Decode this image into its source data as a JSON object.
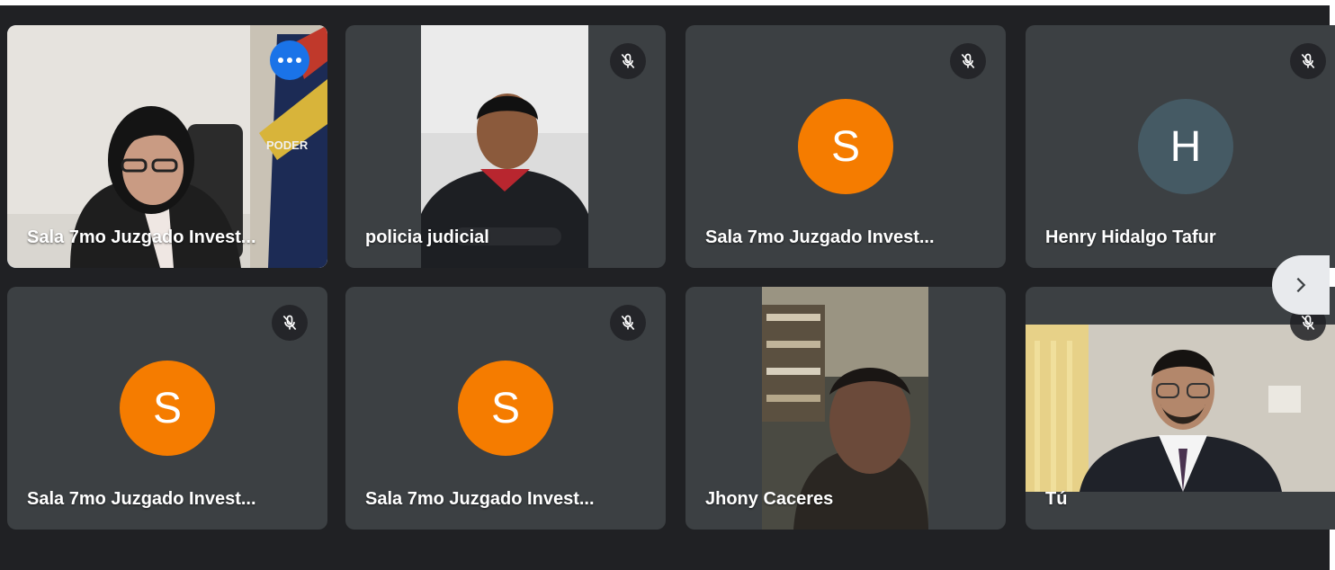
{
  "participants": [
    {
      "name": "Sala 7mo Juzgado Invest...",
      "muted": false,
      "video": true,
      "speaking": true
    },
    {
      "name": "policia judicial",
      "muted": true,
      "video": true
    },
    {
      "name": "Sala 7mo Juzgado Invest...",
      "muted": true,
      "video": false,
      "initial": "S",
      "avatar_color": "#f57c00"
    },
    {
      "name": "Henry Hidalgo Tafur",
      "muted": true,
      "video": false,
      "initial": "H",
      "avatar_color": "#455a64"
    },
    {
      "name": "Sala 7mo Juzgado Invest...",
      "muted": true,
      "video": false,
      "initial": "S",
      "avatar_color": "#f57c00"
    },
    {
      "name": "Sala 7mo Juzgado Invest...",
      "muted": true,
      "video": false,
      "initial": "S",
      "avatar_color": "#f57c00"
    },
    {
      "name": "Jhony Caceres",
      "muted": false,
      "video": true
    },
    {
      "name": "Tú",
      "muted": true,
      "video": true
    }
  ],
  "flag_text": "PODER",
  "colors": {
    "background": "#202124",
    "tile": "#3c4043",
    "active_border": "#8ab4f8",
    "more_button": "#1a73e8"
  },
  "icons": {
    "muted": "mic-off-icon",
    "more": "more-options-icon",
    "next": "chevron-right-icon"
  }
}
